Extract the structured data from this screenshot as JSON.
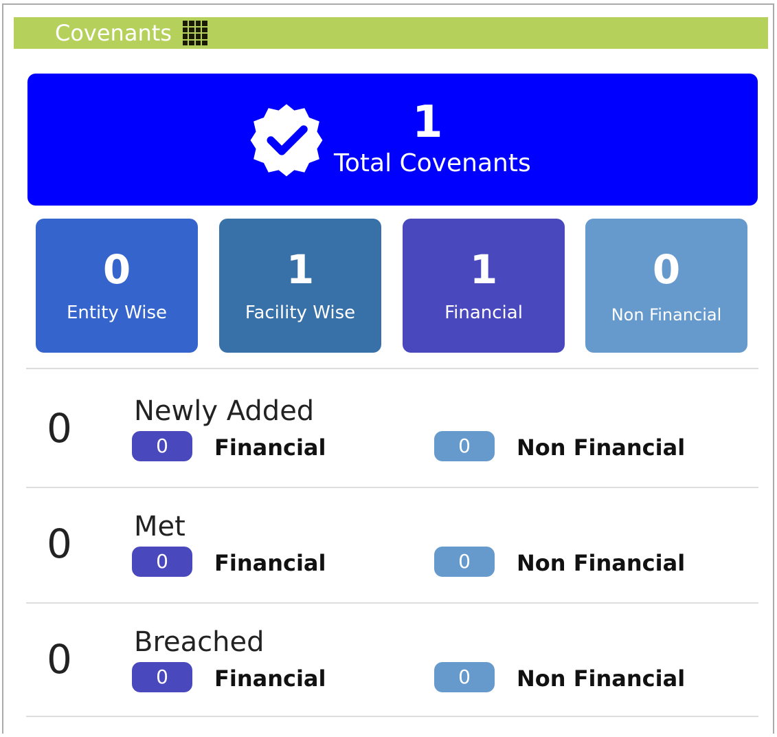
{
  "header": {
    "title": "Covenants",
    "icon": "grid-icon"
  },
  "total": {
    "value": "1",
    "label": "Total Covenants",
    "icon": "verified-badge-icon",
    "color": "#0000ff"
  },
  "tiles": [
    {
      "value": "0",
      "label": "Entity Wise",
      "color": "#3464cc"
    },
    {
      "value": "1",
      "label": "Facility Wise",
      "color": "#3870a8"
    },
    {
      "value": "1",
      "label": "Financial",
      "color": "#4a48bd"
    },
    {
      "value": "0",
      "label": "Non Financial",
      "color": "#6699cc"
    }
  ],
  "rows": [
    {
      "count": "0",
      "title": "Newly Added",
      "financial": "0",
      "financial_label": "Financial",
      "non_financial": "0",
      "non_financial_label": "Non Financial"
    },
    {
      "count": "0",
      "title": "Met",
      "financial": "0",
      "financial_label": "Financial",
      "non_financial": "0",
      "non_financial_label": "Non Financial"
    },
    {
      "count": "0",
      "title": "Breached",
      "financial": "0",
      "financial_label": "Financial",
      "non_financial": "0",
      "non_financial_label": "Non Financial"
    }
  ],
  "colors": {
    "header_bg": "#b5d15b",
    "financial_pill": "#4a48bd",
    "non_financial_pill": "#6699cc"
  }
}
